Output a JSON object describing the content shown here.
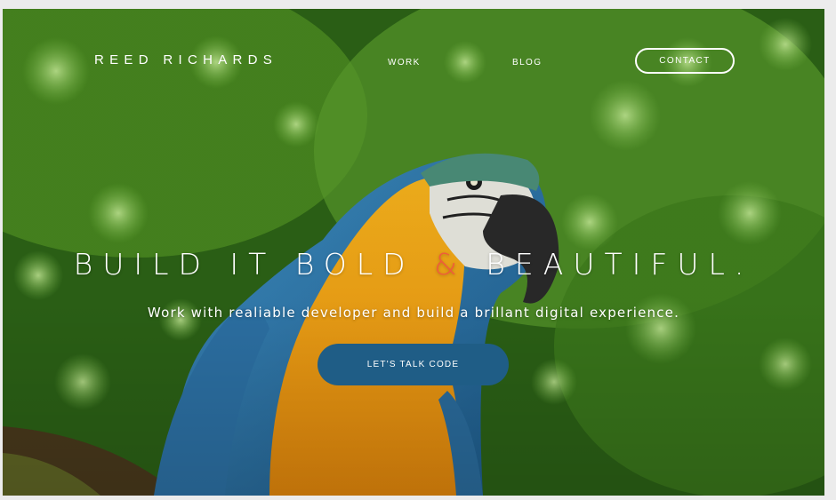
{
  "brand": {
    "name": "REED RICHARDS"
  },
  "nav": {
    "items": [
      {
        "label": "WORK"
      },
      {
        "label": "BLOG"
      }
    ],
    "contact_label": "CONTACT"
  },
  "hero": {
    "headline_before": "BUILD IT BOLD ",
    "headline_amp": "&",
    "headline_after": " BEAUTIFUL.",
    "subheadline": "Work with realiable developer and build a brillant digital experience.",
    "cta_label": "LET'S TALK CODE",
    "background_image": "blue-and-yellow-macaw-photo"
  },
  "colors": {
    "accent_ampersand": "#f05a3c",
    "cta_background": "#1f5d86",
    "text": "#ffffff"
  }
}
